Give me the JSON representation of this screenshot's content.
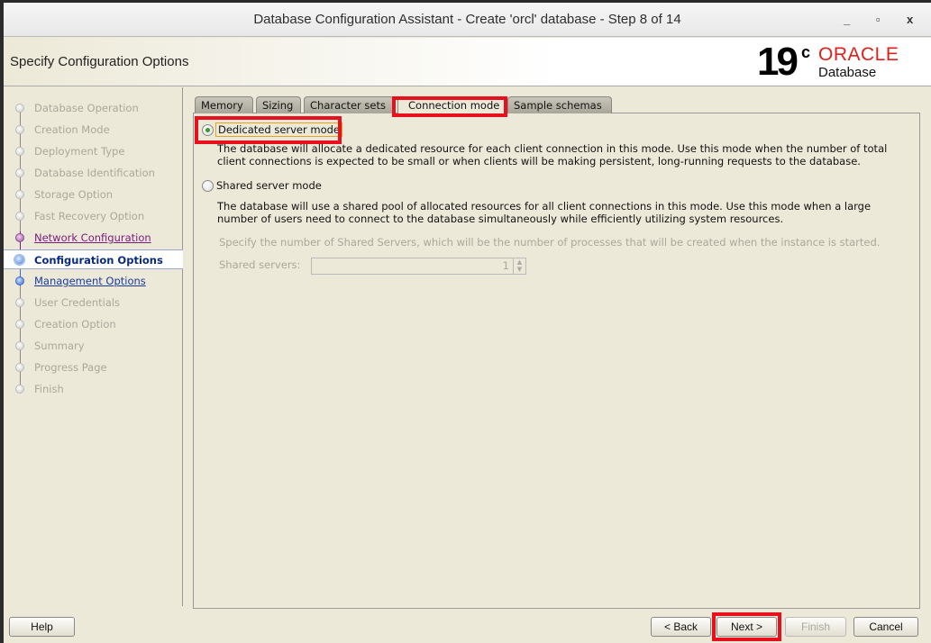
{
  "window": {
    "title": "Database Configuration Assistant - Create 'orcl' database - Step 8 of 14",
    "minimize": "_",
    "maximize": "▫",
    "close": "x"
  },
  "header": {
    "page_title": "Specify Configuration Options",
    "logo_version": "19",
    "logo_superscript": "c",
    "logo_brand": "ORACLE",
    "logo_product": "Database"
  },
  "sidebar": {
    "steps": [
      {
        "label": "Database Operation",
        "state": "done"
      },
      {
        "label": "Creation Mode",
        "state": "done"
      },
      {
        "label": "Deployment Type",
        "state": "done"
      },
      {
        "label": "Database Identification",
        "state": "done"
      },
      {
        "label": "Storage Option",
        "state": "done"
      },
      {
        "label": "Fast Recovery Option",
        "state": "done"
      },
      {
        "label": "Network Configuration",
        "state": "visited"
      },
      {
        "label": "Configuration Options",
        "state": "current"
      },
      {
        "label": "Management Options",
        "state": "next"
      },
      {
        "label": "User Credentials",
        "state": "pending"
      },
      {
        "label": "Creation Option",
        "state": "pending"
      },
      {
        "label": "Summary",
        "state": "pending"
      },
      {
        "label": "Progress Page",
        "state": "pending"
      },
      {
        "label": "Finish",
        "state": "pending"
      }
    ]
  },
  "tabs": [
    "Memory",
    "Sizing",
    "Character sets",
    "Connection mode",
    "Sample schemas"
  ],
  "active_tab": "Connection mode",
  "connection": {
    "dedicated_label": "Dedicated server mode",
    "dedicated_desc": "The database will allocate a dedicated resource for each client connection in this mode. Use this mode when the number of total client connections is expected to be small or when clients will be making persistent, long-running requests to the database.",
    "shared_label": "Shared server mode",
    "shared_desc": "The database will use a shared pool of allocated resources for all client connections in this mode.  Use this mode when a large number of users need to connect to the database simultaneously while efficiently utilizing system resources.",
    "shared_hint": "Specify the number of Shared Servers, which will be the number of processes that will be created when the instance is started.",
    "shared_servers_label": "Shared servers:",
    "shared_servers_value": "1",
    "selected": "dedicated"
  },
  "buttons": {
    "help": "Help",
    "back": "< Back",
    "next": "Next >",
    "finish": "Finish",
    "cancel": "Cancel"
  },
  "colors": {
    "highlight": "#e8101c",
    "oracle_red": "#e0201b"
  }
}
